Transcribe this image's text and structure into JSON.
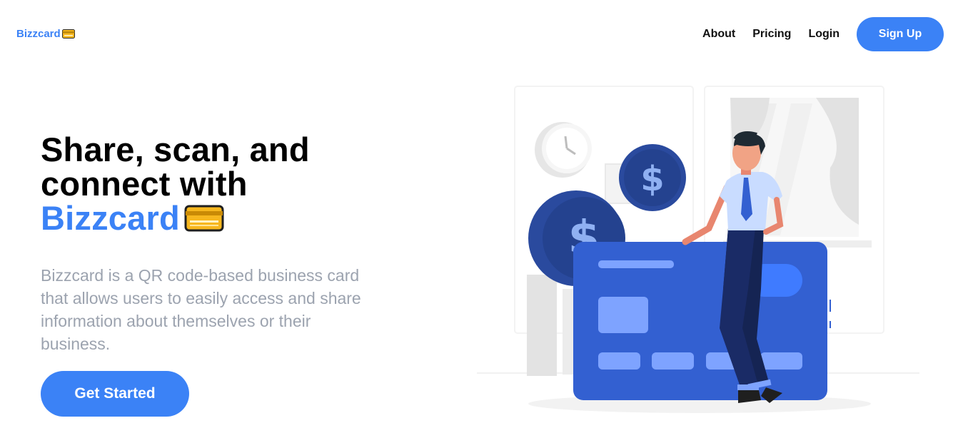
{
  "nav": {
    "logo_text": "Bizzcard",
    "links": [
      "About",
      "Pricing",
      "Login"
    ],
    "signup_label": "Sign Up"
  },
  "hero": {
    "title_line1": "Share, scan, and",
    "title_line2": "connect with",
    "title_brand": "Bizzcard",
    "description": "Bizzcard is a QR code-based business card that allows users to easily access and share information about themselves or their business.",
    "cta_label": "Get Started"
  },
  "icons": {
    "logo_icon": "credit-card-icon",
    "brand_icon": "credit-card-icon",
    "coin_icon": "dollar-coin-icon"
  },
  "colors": {
    "accent": "#3b82f6",
    "card_blue": "#3360d1",
    "coin_navy": "#2a4a9e",
    "text_muted": "#9ca3af",
    "card_emoji": "#f7b71e"
  }
}
